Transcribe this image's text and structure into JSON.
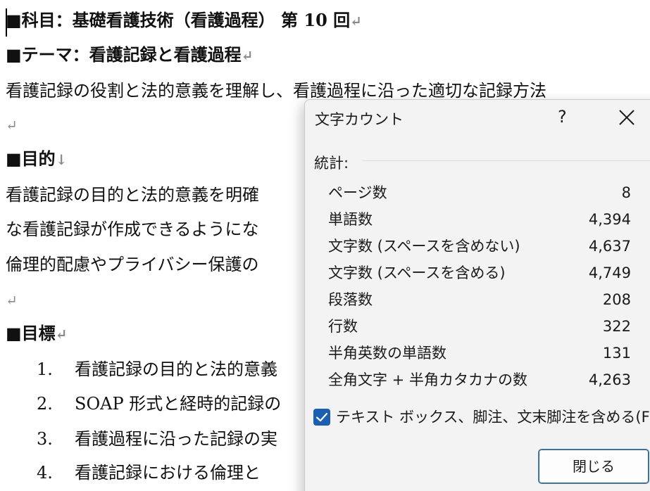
{
  "document": {
    "heading_subject": "■科目：基礎看護技術（看護過程） 第 10 回",
    "heading_theme": "■テーマ：看護記録と看護過程",
    "body_line1": "看護記録の役割と法的意義を理解し、看護過程に沿った適切な記録方法",
    "heading_purpose": "■目的",
    "purpose_line1": "看護記録の目的と法的意義を明確",
    "purpose_line2": "な看護記録が作成できるようにな",
    "purpose_line3": "倫理的配慮やプライバシー保護の",
    "heading_goals": "■目標",
    "goals": [
      {
        "num": "1.",
        "text": "看護記録の目的と法的意義"
      },
      {
        "num": "2.",
        "text": "SOAP 形式と経時的記録の"
      },
      {
        "num": "3.",
        "text": "看護過程に沿った記録の実"
      },
      {
        "num": "4.",
        "text": "看護記録における倫理と"
      }
    ],
    "para_mark": "↵",
    "line_break_mark": "↓"
  },
  "dialog": {
    "title": "文字カウント",
    "help": "?",
    "section_label": "統計:",
    "stats": [
      {
        "label": "ページ数",
        "value": "8"
      },
      {
        "label": "単語数",
        "value": "4,394"
      },
      {
        "label": "文字数 (スペースを含めない)",
        "value": "4,637"
      },
      {
        "label": "文字数 (スペースを含める)",
        "value": "4,749"
      },
      {
        "label": "段落数",
        "value": "208"
      },
      {
        "label": "行数",
        "value": "322"
      },
      {
        "label": "半角英数の単語数",
        "value": "131"
      },
      {
        "label": "全角文字 + 半角カタカナの数",
        "value": "4,263"
      }
    ],
    "checkbox_label": "テキスト ボックス、脚注、文末脚注を含める(F)",
    "checkbox_checked": true,
    "close_button": "閉じる",
    "accent_color": "#1a5fb4"
  }
}
